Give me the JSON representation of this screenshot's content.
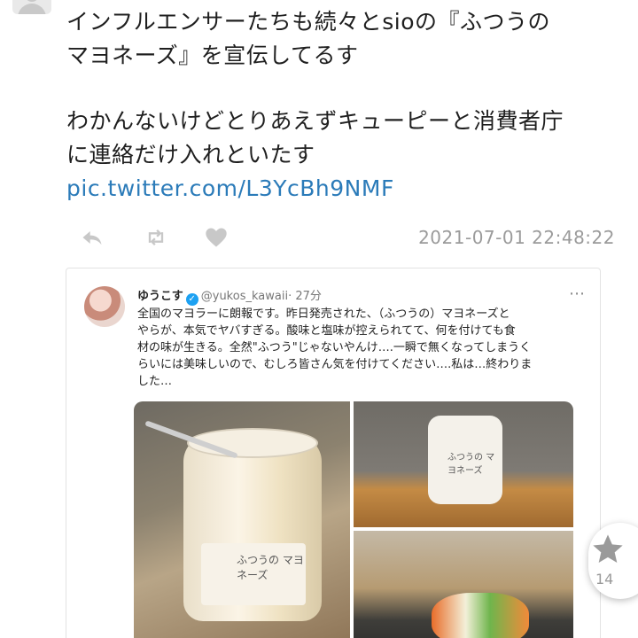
{
  "tweet": {
    "lines": [
      "インフルエンサーたちも続々とsioの『ふつうの",
      "マヨネーズ』を宣伝してるす"
    ],
    "lines2": [
      "わかんないけどとりあえずキューピーと消費者庁",
      "に連絡だけ入れといたす"
    ],
    "link": "pic.twitter.com/L3YcBh9NMF",
    "timestamp": "2021-07-01 22:48:22"
  },
  "actions": {
    "reply_icon": "reply-icon",
    "retweet_icon": "retweet-icon",
    "like_icon": "heart-icon"
  },
  "embed": {
    "name": "ゆうこす",
    "verified": "✓",
    "handle": "@yukos_kawaii",
    "time": "· 27分",
    "more": "⋯",
    "body": [
      "全国のマヨラーに朗報です。昨日発売された、（ふつうの）マヨネーズと",
      "やらが、本気でヤバすぎる。酸味と塩味が控えられてて、何を付けても食",
      "材の味が生きる。全然\"ふつう\"じゃないやんけ….一瞬で無くなってしまうく",
      "らいには美味しいので、むしろ皆さん気を付けてください….私は…終わりま",
      "した…"
    ],
    "photo1_label": "ふつうの マヨネーズ",
    "photo2_label": "ふつうの マヨネーズ"
  },
  "fab": {
    "icon": "star-icon",
    "count": "14"
  },
  "colors": {
    "link": "#2b7bb9",
    "icon_gray": "#c8c8c8",
    "timestamp": "#9b9b9b",
    "verified": "#1da1f2"
  }
}
